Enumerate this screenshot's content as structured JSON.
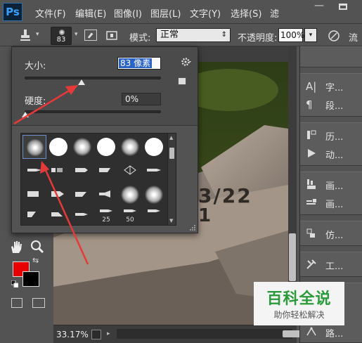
{
  "menu": [
    "文件(F)",
    "编辑(E)",
    "图像(I)",
    "图层(L)",
    "文字(Y)",
    "选择(S)",
    "滤"
  ],
  "app_logo": "Ps",
  "window": {
    "minimize": "—"
  },
  "options": {
    "brush_size": "83",
    "mode_label": "模式:",
    "mode_value": "正常",
    "opacity_label": "不透明度:",
    "opacity_value": "100%",
    "flow_label": "流"
  },
  "brush_popup": {
    "size_label": "大小:",
    "size_value": "83 像素",
    "size_slider": 0.42,
    "hardness_label": "硬度:",
    "hardness_value": "0%",
    "hardness_slider": 0.0,
    "preset_labels": [
      "25",
      "50"
    ]
  },
  "canvas_text": {
    "line1": "3/22",
    "line2": "1"
  },
  "status": {
    "zoom": "33.17%"
  },
  "panels": [
    {
      "label": "字...",
      "icon": "character-icon"
    },
    {
      "label": "段...",
      "icon": "paragraph-icon"
    },
    {
      "label": "历...",
      "icon": "history-icon"
    },
    {
      "label": "动...",
      "icon": "actions-icon"
    },
    {
      "label": "画...",
      "icon": "brush-panel-icon"
    },
    {
      "label": "画...",
      "icon": "brush-presets-icon"
    },
    {
      "label": "仿...",
      "icon": "clone-source-icon"
    },
    {
      "label": "工...",
      "icon": "tool-presets-icon"
    },
    {
      "label": "路...",
      "icon": "paths-icon"
    }
  ],
  "watermark": {
    "title": "百科全说",
    "subtitle": "助你轻松解决"
  },
  "colors": {
    "foreground": "#e80000",
    "background": "#000000",
    "accent": "#e63a3a"
  }
}
